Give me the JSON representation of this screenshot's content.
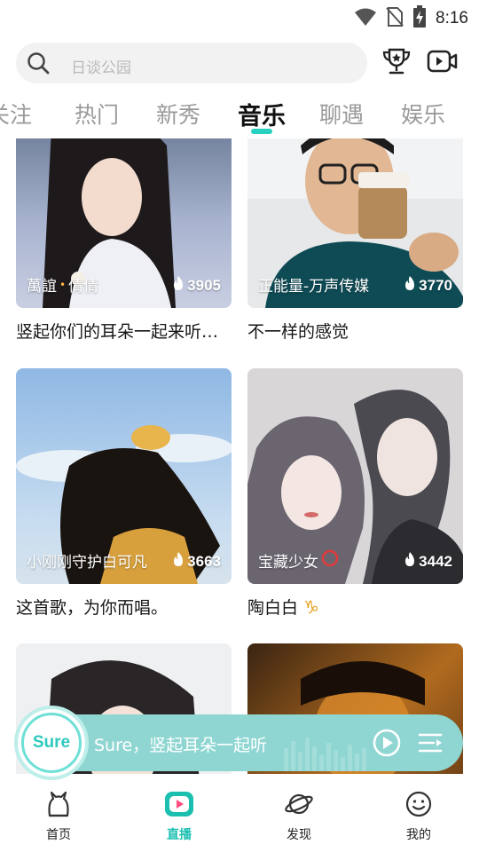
{
  "status": {
    "time": "8:16"
  },
  "header": {
    "search_placeholder": "日谈公园",
    "trophy_icon": "trophy-icon",
    "video_icon": "video-camera-icon"
  },
  "tabs": [
    {
      "label": "关注"
    },
    {
      "label": "热门"
    },
    {
      "label": "新秀"
    },
    {
      "label": "音乐",
      "active": true
    },
    {
      "label": "聊遇"
    },
    {
      "label": "娱乐"
    }
  ],
  "cards": [
    {
      "host": "萬誼",
      "host_suffix": "倩倩",
      "heat": "3905",
      "title": "竖起你们的耳朵一起来听…"
    },
    {
      "host": "正能量-万声传媒",
      "heat": "3770",
      "title": "不一样的感觉"
    },
    {
      "host": "小刚刚守护白可凡",
      "heat": "3663",
      "title": "这首歌，为你而唱。"
    },
    {
      "host": "宝藏少女",
      "heat": "3442",
      "title": "陶白白",
      "title_symbol": "♑"
    },
    {
      "host": "",
      "heat": "",
      "title": ""
    },
    {
      "host": "",
      "heat": "",
      "title": ""
    }
  ],
  "player": {
    "logo_text": "Sure",
    "title": "Sure，竖起耳朵一起听"
  },
  "nav": [
    {
      "label": "首页"
    },
    {
      "label": "直播",
      "active": true
    },
    {
      "label": "发现"
    },
    {
      "label": "我的"
    }
  ],
  "colors": {
    "accent": "#27d0c0",
    "player_bg": "#8fd6d2",
    "nav_active": "#1bbfb0"
  }
}
